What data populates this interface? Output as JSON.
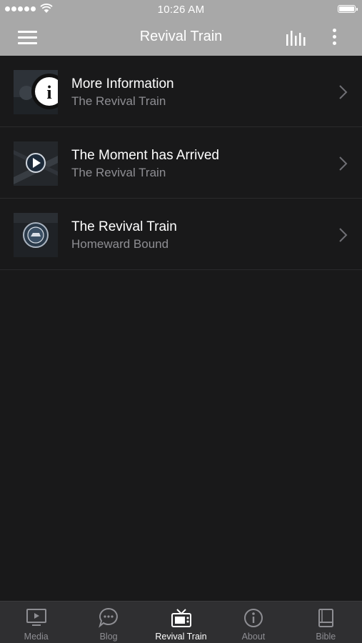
{
  "status_bar": {
    "time": "10:26 AM"
  },
  "nav": {
    "title": "Revival Train"
  },
  "items": [
    {
      "title": "More Information",
      "subtitle": "The Revival Train",
      "thumbnail_icon": "info-icon"
    },
    {
      "title": "The Moment has Arrived",
      "subtitle": "The Revival Train",
      "thumbnail_icon": "play-icon"
    },
    {
      "title": "The Revival Train",
      "subtitle": "Homeward Bound",
      "thumbnail_icon": "emblem-icon"
    }
  ],
  "tabs": [
    {
      "label": "Media",
      "icon": "video-icon",
      "active": false
    },
    {
      "label": "Blog",
      "icon": "chat-bubble-icon",
      "active": false
    },
    {
      "label": "Revival Train",
      "icon": "tv-icon",
      "active": true
    },
    {
      "label": "About",
      "icon": "info-circle-icon",
      "active": false
    },
    {
      "label": "Bible",
      "icon": "book-icon",
      "active": false
    }
  ],
  "colors": {
    "header_bg": "#a8a8a8",
    "list_bg": "#19191a",
    "tabbar_bg": "#2f2f31",
    "inactive": "#8e8e93",
    "active": "#ffffff"
  }
}
